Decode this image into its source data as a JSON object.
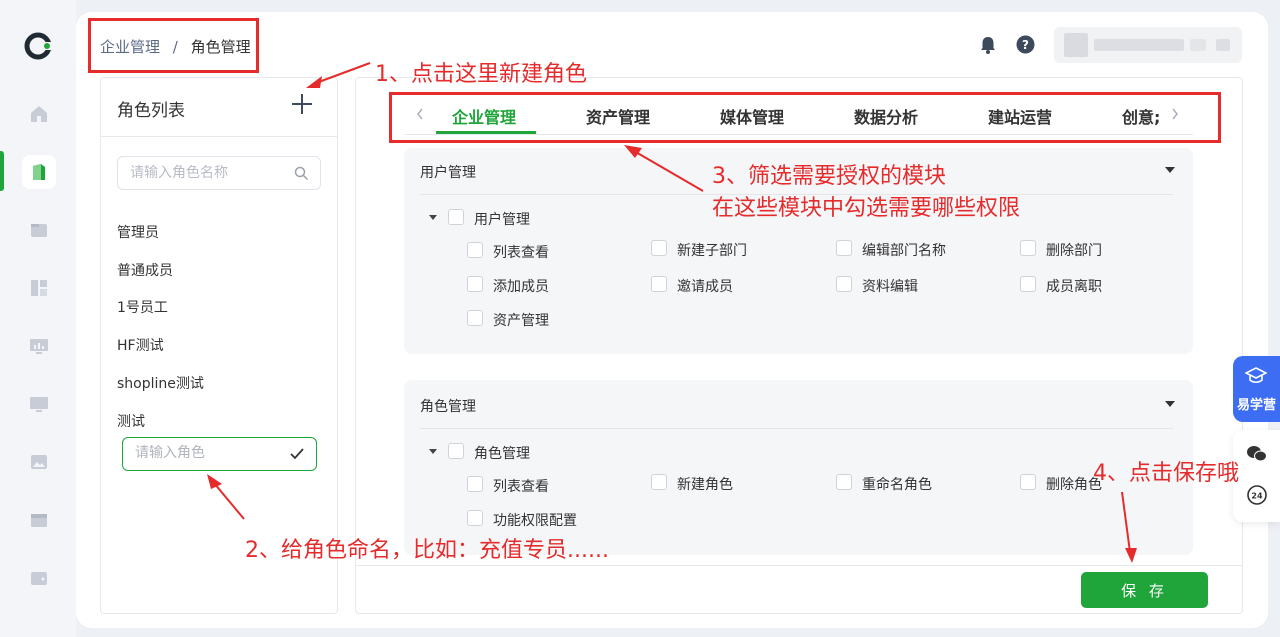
{
  "breadcrumb": {
    "parent": "企业管理",
    "separator": "/",
    "current": "角色管理"
  },
  "role_panel": {
    "title": "角色列表",
    "search_placeholder": "请输入角色名称",
    "roles": [
      "管理员",
      "普通成员",
      "1号员工",
      "HF测试",
      "shopline测试",
      "测试"
    ],
    "new_role_placeholder": "请输入角色"
  },
  "tabs": [
    "企业管理",
    "资产管理",
    "媒体管理",
    "数据分析",
    "建站运营",
    "创意;"
  ],
  "active_tab": "企业管理",
  "sections": [
    {
      "title": "用户管理",
      "group": "用户管理",
      "permissions": [
        "列表查看",
        "新建子部门",
        "编辑部门名称",
        "删除部门",
        "添加成员",
        "邀请成员",
        "资料编辑",
        "成员离职",
        "资产管理"
      ]
    },
    {
      "title": "角色管理",
      "group": "角色管理",
      "permissions": [
        "列表查看",
        "新建角色",
        "重命名角色",
        "删除角色",
        "功能权限配置"
      ]
    }
  ],
  "save_label": "保 存",
  "float_widget": {
    "label": "易学营"
  },
  "annotations": {
    "a1": "1、点击这里新建角色",
    "a2": "2、给角色命名，比如：充值专员......",
    "a3_line1": "3、筛选需要授权的模块",
    "a3_line2": "在这些模块中勾选需要哪些权限",
    "a4": "4、点击保存哦"
  },
  "colors": {
    "accent": "#20a53a",
    "annotation": "#e52b2b",
    "float_blue": "#3d6df2"
  }
}
